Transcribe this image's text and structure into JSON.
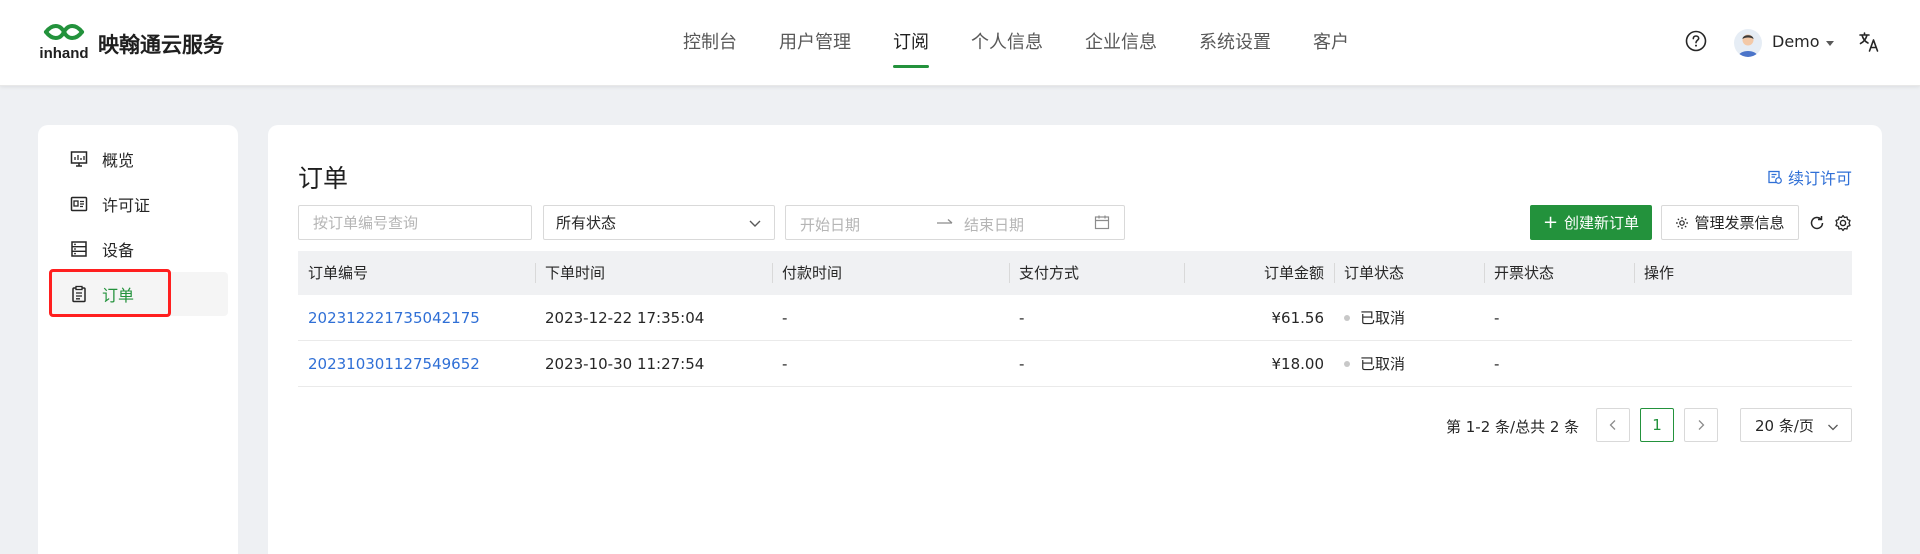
{
  "brand": {
    "name": "映翰通云服务",
    "logo_text": "inhand"
  },
  "nav": [
    {
      "label": "控制台"
    },
    {
      "label": "用户管理"
    },
    {
      "label": "订阅",
      "active": true
    },
    {
      "label": "个人信息"
    },
    {
      "label": "企业信息"
    },
    {
      "label": "系统设置"
    },
    {
      "label": "客户"
    }
  ],
  "user": {
    "name": "Demo"
  },
  "icons": {
    "help": "help-circle-icon",
    "language": "translate-icon",
    "caret": "caret-down-icon"
  },
  "sidebar": {
    "items": [
      {
        "label": "概览",
        "icon": "dashboard-icon"
      },
      {
        "label": "许可证",
        "icon": "license-icon"
      },
      {
        "label": "设备",
        "icon": "device-icon"
      },
      {
        "label": "订单",
        "icon": "order-icon",
        "active": true
      }
    ]
  },
  "main": {
    "title": "订单",
    "renew_link": "续订许可",
    "filters": {
      "search_placeholder": "按订单编号查询",
      "status_value": "所有状态",
      "date_start_placeholder": "开始日期",
      "date_end_placeholder": "结束日期"
    },
    "buttons": {
      "create": "创建新订单",
      "invoice": "管理发票信息"
    },
    "table": {
      "headers": [
        "订单编号",
        "下单时间",
        "付款时间",
        "支付方式",
        "订单金额",
        "订单状态",
        "开票状态",
        "操作"
      ],
      "rows": [
        {
          "order_no": "202312221735042175",
          "order_time": "2023-12-22 17:35:04",
          "pay_time": "-",
          "pay_method": "-",
          "amount": "¥61.56",
          "status": "已取消",
          "invoice_status": "-",
          "action": ""
        },
        {
          "order_no": "202310301127549652",
          "order_time": "2023-10-30 11:27:54",
          "pay_time": "-",
          "pay_method": "-",
          "amount": "¥18.00",
          "status": "已取消",
          "invoice_status": "-",
          "action": ""
        }
      ]
    },
    "pagination": {
      "summary": "第 1-2 条/总共 2 条",
      "current_page": "1",
      "page_size": "20 条/页"
    }
  },
  "colors": {
    "primary": "#23923c",
    "link": "#2f6fd6",
    "highlight": "#ff1f1f",
    "status_dot": "#c8c8c8"
  }
}
